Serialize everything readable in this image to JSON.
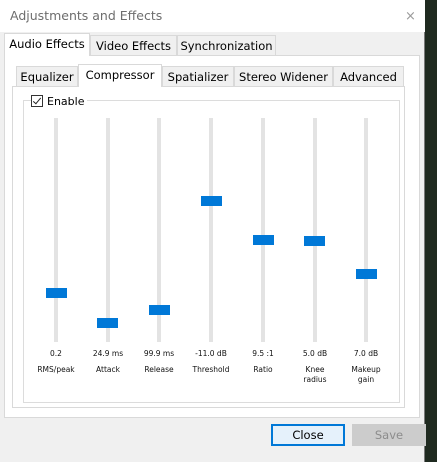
{
  "window": {
    "title": "Adjustments and Effects",
    "close_glyph": "×"
  },
  "main_tabs": [
    {
      "label": "Audio Effects",
      "active": true
    },
    {
      "label": "Video Effects",
      "active": false
    },
    {
      "label": "Synchronization",
      "active": false
    }
  ],
  "sub_tabs": [
    {
      "label": "Equalizer",
      "active": false
    },
    {
      "label": "Compressor",
      "active": true
    },
    {
      "label": "Spatializer",
      "active": false
    },
    {
      "label": "Stereo Widener",
      "active": false
    },
    {
      "label": "Advanced",
      "active": false
    }
  ],
  "enable": {
    "label": "Enable",
    "checked": true
  },
  "sliders": [
    {
      "value": "0.2",
      "label": "RMS/peak",
      "level": 0.2
    },
    {
      "value": "24.9 ms",
      "label": "Attack",
      "level": 0.05
    },
    {
      "value": "99.9 ms",
      "label": "Release",
      "level": 0.13
    },
    {
      "value": "-11.0 dB",
      "label": "Threshold",
      "level": 0.64
    },
    {
      "value": "9.5 :1",
      "label": "Ratio",
      "level": 0.45
    },
    {
      "value": "5.0 dB",
      "label": "Knee radius",
      "label_line1": "Knee",
      "label_line2": "radius",
      "level": 0.45
    },
    {
      "value": "7.0 dB",
      "label": "Makeup gain",
      "label_line1": "Makeup",
      "label_line2": "gain",
      "level": 0.29
    }
  ],
  "buttons": {
    "close": "Close",
    "save": "Save"
  },
  "colors": {
    "accent": "#0078d7",
    "track": "#e3e3e3"
  }
}
